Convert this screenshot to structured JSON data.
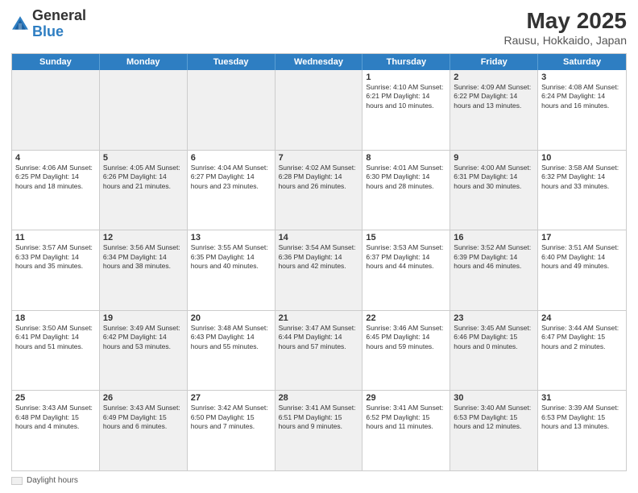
{
  "header": {
    "logo_general": "General",
    "logo_blue": "Blue",
    "month_title": "May 2025",
    "location": "Rausu, Hokkaido, Japan"
  },
  "calendar": {
    "days_of_week": [
      "Sunday",
      "Monday",
      "Tuesday",
      "Wednesday",
      "Thursday",
      "Friday",
      "Saturday"
    ],
    "weeks": [
      [
        {
          "day": "",
          "info": "",
          "shaded": true
        },
        {
          "day": "",
          "info": "",
          "shaded": true
        },
        {
          "day": "",
          "info": "",
          "shaded": true
        },
        {
          "day": "",
          "info": "",
          "shaded": true
        },
        {
          "day": "1",
          "info": "Sunrise: 4:10 AM\nSunset: 6:21 PM\nDaylight: 14 hours\nand 10 minutes."
        },
        {
          "day": "2",
          "info": "Sunrise: 4:09 AM\nSunset: 6:22 PM\nDaylight: 14 hours\nand 13 minutes.",
          "shaded": true
        },
        {
          "day": "3",
          "info": "Sunrise: 4:08 AM\nSunset: 6:24 PM\nDaylight: 14 hours\nand 16 minutes."
        }
      ],
      [
        {
          "day": "4",
          "info": "Sunrise: 4:06 AM\nSunset: 6:25 PM\nDaylight: 14 hours\nand 18 minutes."
        },
        {
          "day": "5",
          "info": "Sunrise: 4:05 AM\nSunset: 6:26 PM\nDaylight: 14 hours\nand 21 minutes.",
          "shaded": true
        },
        {
          "day": "6",
          "info": "Sunrise: 4:04 AM\nSunset: 6:27 PM\nDaylight: 14 hours\nand 23 minutes."
        },
        {
          "day": "7",
          "info": "Sunrise: 4:02 AM\nSunset: 6:28 PM\nDaylight: 14 hours\nand 26 minutes.",
          "shaded": true
        },
        {
          "day": "8",
          "info": "Sunrise: 4:01 AM\nSunset: 6:30 PM\nDaylight: 14 hours\nand 28 minutes."
        },
        {
          "day": "9",
          "info": "Sunrise: 4:00 AM\nSunset: 6:31 PM\nDaylight: 14 hours\nand 30 minutes.",
          "shaded": true
        },
        {
          "day": "10",
          "info": "Sunrise: 3:58 AM\nSunset: 6:32 PM\nDaylight: 14 hours\nand 33 minutes."
        }
      ],
      [
        {
          "day": "11",
          "info": "Sunrise: 3:57 AM\nSunset: 6:33 PM\nDaylight: 14 hours\nand 35 minutes."
        },
        {
          "day": "12",
          "info": "Sunrise: 3:56 AM\nSunset: 6:34 PM\nDaylight: 14 hours\nand 38 minutes.",
          "shaded": true
        },
        {
          "day": "13",
          "info": "Sunrise: 3:55 AM\nSunset: 6:35 PM\nDaylight: 14 hours\nand 40 minutes."
        },
        {
          "day": "14",
          "info": "Sunrise: 3:54 AM\nSunset: 6:36 PM\nDaylight: 14 hours\nand 42 minutes.",
          "shaded": true
        },
        {
          "day": "15",
          "info": "Sunrise: 3:53 AM\nSunset: 6:37 PM\nDaylight: 14 hours\nand 44 minutes."
        },
        {
          "day": "16",
          "info": "Sunrise: 3:52 AM\nSunset: 6:39 PM\nDaylight: 14 hours\nand 46 minutes.",
          "shaded": true
        },
        {
          "day": "17",
          "info": "Sunrise: 3:51 AM\nSunset: 6:40 PM\nDaylight: 14 hours\nand 49 minutes."
        }
      ],
      [
        {
          "day": "18",
          "info": "Sunrise: 3:50 AM\nSunset: 6:41 PM\nDaylight: 14 hours\nand 51 minutes."
        },
        {
          "day": "19",
          "info": "Sunrise: 3:49 AM\nSunset: 6:42 PM\nDaylight: 14 hours\nand 53 minutes.",
          "shaded": true
        },
        {
          "day": "20",
          "info": "Sunrise: 3:48 AM\nSunset: 6:43 PM\nDaylight: 14 hours\nand 55 minutes."
        },
        {
          "day": "21",
          "info": "Sunrise: 3:47 AM\nSunset: 6:44 PM\nDaylight: 14 hours\nand 57 minutes.",
          "shaded": true
        },
        {
          "day": "22",
          "info": "Sunrise: 3:46 AM\nSunset: 6:45 PM\nDaylight: 14 hours\nand 59 minutes."
        },
        {
          "day": "23",
          "info": "Sunrise: 3:45 AM\nSunset: 6:46 PM\nDaylight: 15 hours\nand 0 minutes.",
          "shaded": true
        },
        {
          "day": "24",
          "info": "Sunrise: 3:44 AM\nSunset: 6:47 PM\nDaylight: 15 hours\nand 2 minutes."
        }
      ],
      [
        {
          "day": "25",
          "info": "Sunrise: 3:43 AM\nSunset: 6:48 PM\nDaylight: 15 hours\nand 4 minutes."
        },
        {
          "day": "26",
          "info": "Sunrise: 3:43 AM\nSunset: 6:49 PM\nDaylight: 15 hours\nand 6 minutes.",
          "shaded": true
        },
        {
          "day": "27",
          "info": "Sunrise: 3:42 AM\nSunset: 6:50 PM\nDaylight: 15 hours\nand 7 minutes."
        },
        {
          "day": "28",
          "info": "Sunrise: 3:41 AM\nSunset: 6:51 PM\nDaylight: 15 hours\nand 9 minutes.",
          "shaded": true
        },
        {
          "day": "29",
          "info": "Sunrise: 3:41 AM\nSunset: 6:52 PM\nDaylight: 15 hours\nand 11 minutes."
        },
        {
          "day": "30",
          "info": "Sunrise: 3:40 AM\nSunset: 6:53 PM\nDaylight: 15 hours\nand 12 minutes.",
          "shaded": true
        },
        {
          "day": "31",
          "info": "Sunrise: 3:39 AM\nSunset: 6:53 PM\nDaylight: 15 hours\nand 13 minutes."
        }
      ]
    ]
  },
  "footer": {
    "legend_label": "Daylight hours"
  }
}
